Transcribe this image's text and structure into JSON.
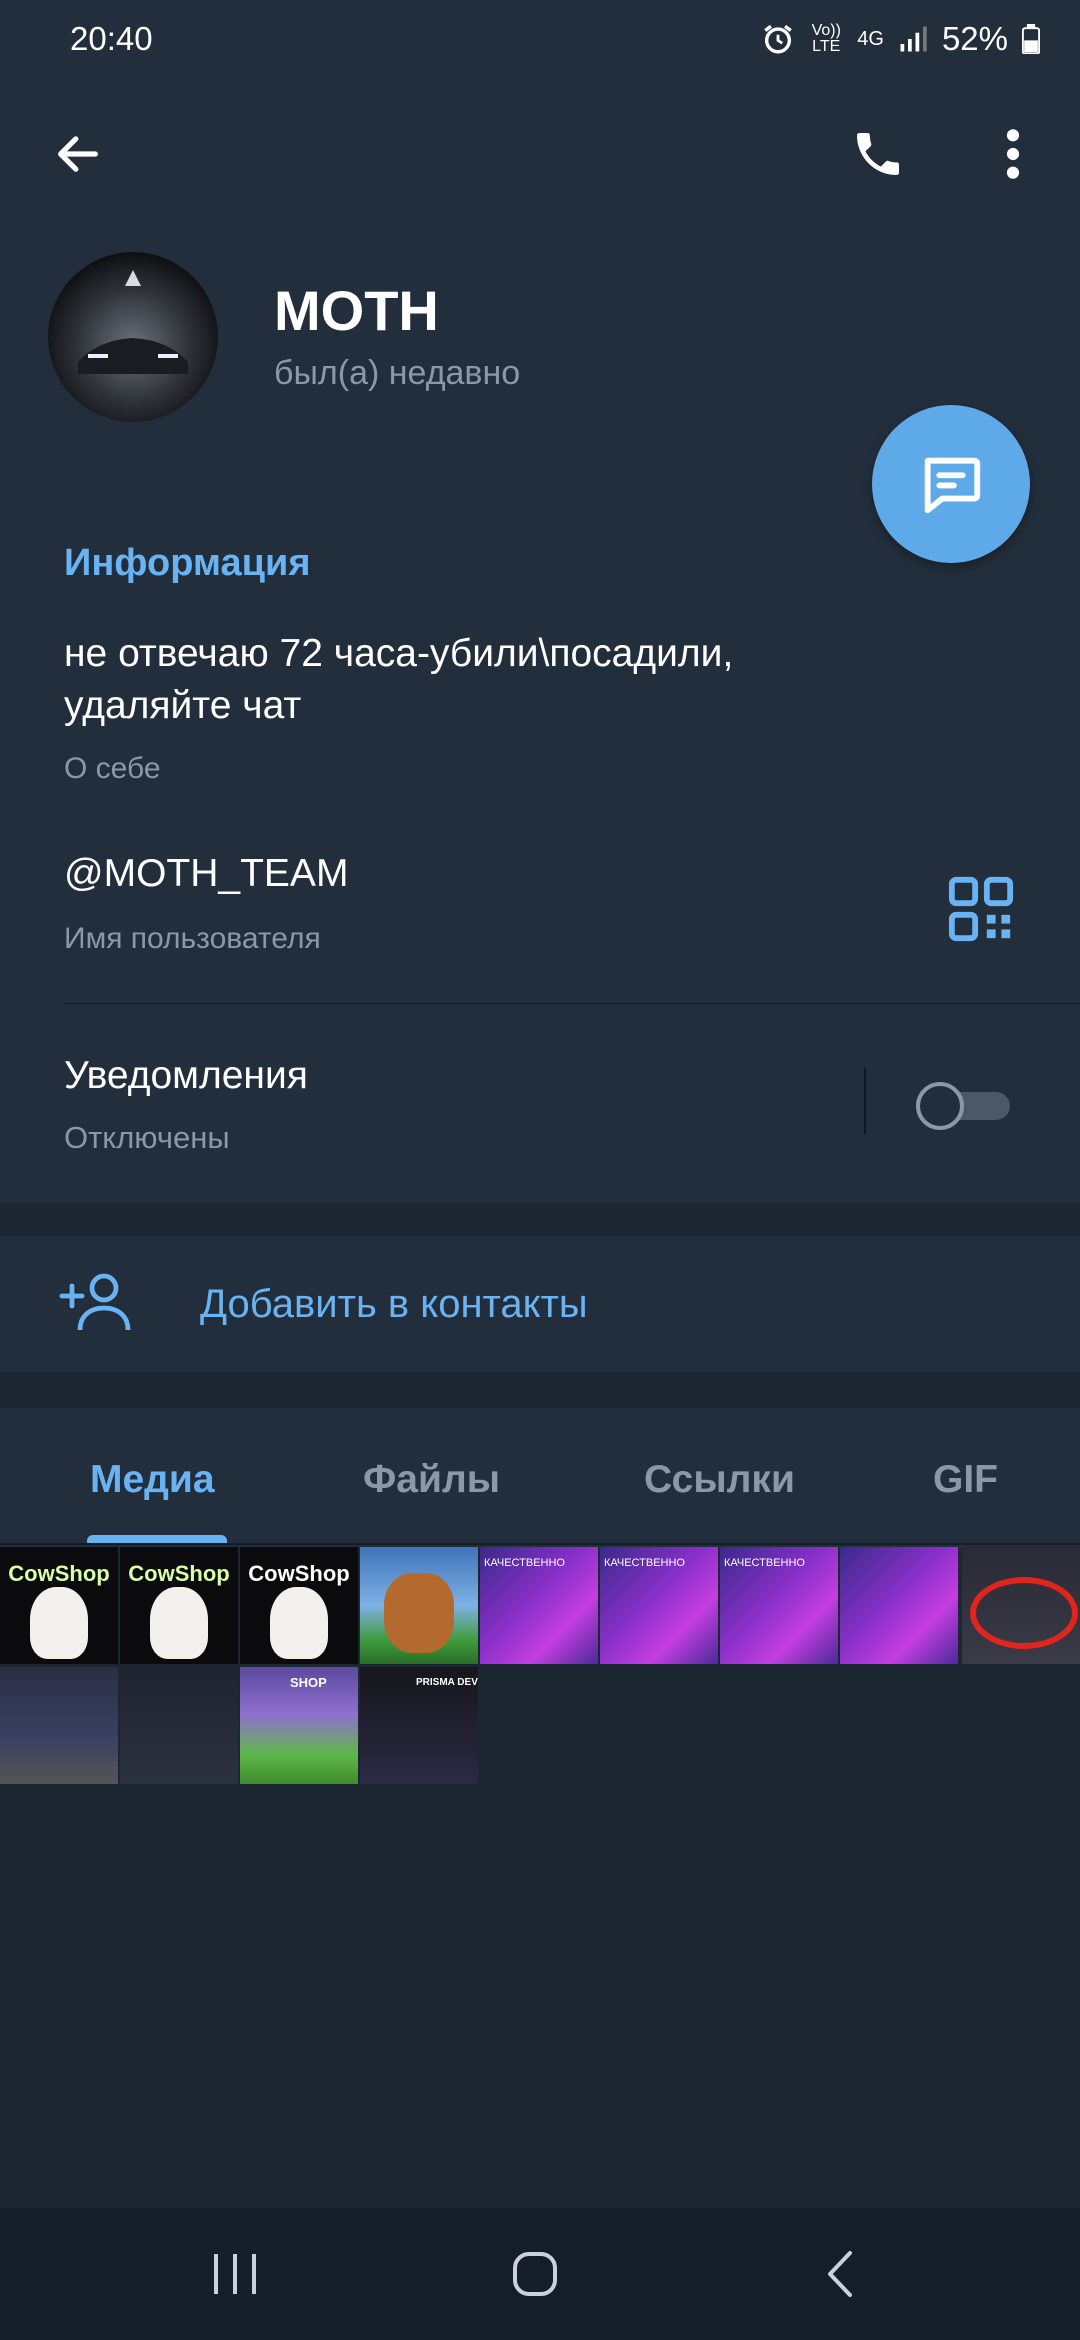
{
  "status_bar": {
    "time": "20:40",
    "volte": "Vo)) LTE",
    "network": "4G",
    "battery": "52%"
  },
  "header": {
    "contact_name": "MOTH",
    "contact_status": "был(а) недавно"
  },
  "info": {
    "section_title": "Информация",
    "bio": "не отвечаю 72 часа-убили\\посадили, удаляйте чат",
    "bio_label": "О себе",
    "username": "@MOTH_TEAM",
    "username_label": "Имя пользователя",
    "notifications_title": "Уведомления",
    "notifications_status": "Отключены",
    "notifications_enabled": false
  },
  "add_contact": {
    "label": "Добавить в контакты"
  },
  "tabs": [
    {
      "label": "Медиа",
      "active": true
    },
    {
      "label": "Файлы",
      "active": false
    },
    {
      "label": "Ссылки",
      "active": false
    },
    {
      "label": "GIF",
      "active": false
    }
  ],
  "media": {
    "thumb_captions": [
      "CowShop",
      "CowShop",
      "CowShop",
      "КАЧЕСТВЕННО",
      "КАЧЕСТВЕННО",
      "КАЧЕСТВЕННО",
      "SHOP",
      "PRISMA DEV"
    ]
  },
  "colors": {
    "accent": "#6ab3f3",
    "fab": "#5eaae9",
    "background": "#1d2733",
    "panel": "#232e3c",
    "secondary_text": "#8a98a8"
  },
  "icons": {
    "back": "arrow-left-icon",
    "call": "phone-icon",
    "more": "more-vertical-icon",
    "message": "message-icon",
    "qr": "qr-code-icon",
    "add_contact": "add-user-icon",
    "nav_recents": "recents-icon",
    "nav_home": "home-icon",
    "nav_back": "back-chevron-icon"
  }
}
